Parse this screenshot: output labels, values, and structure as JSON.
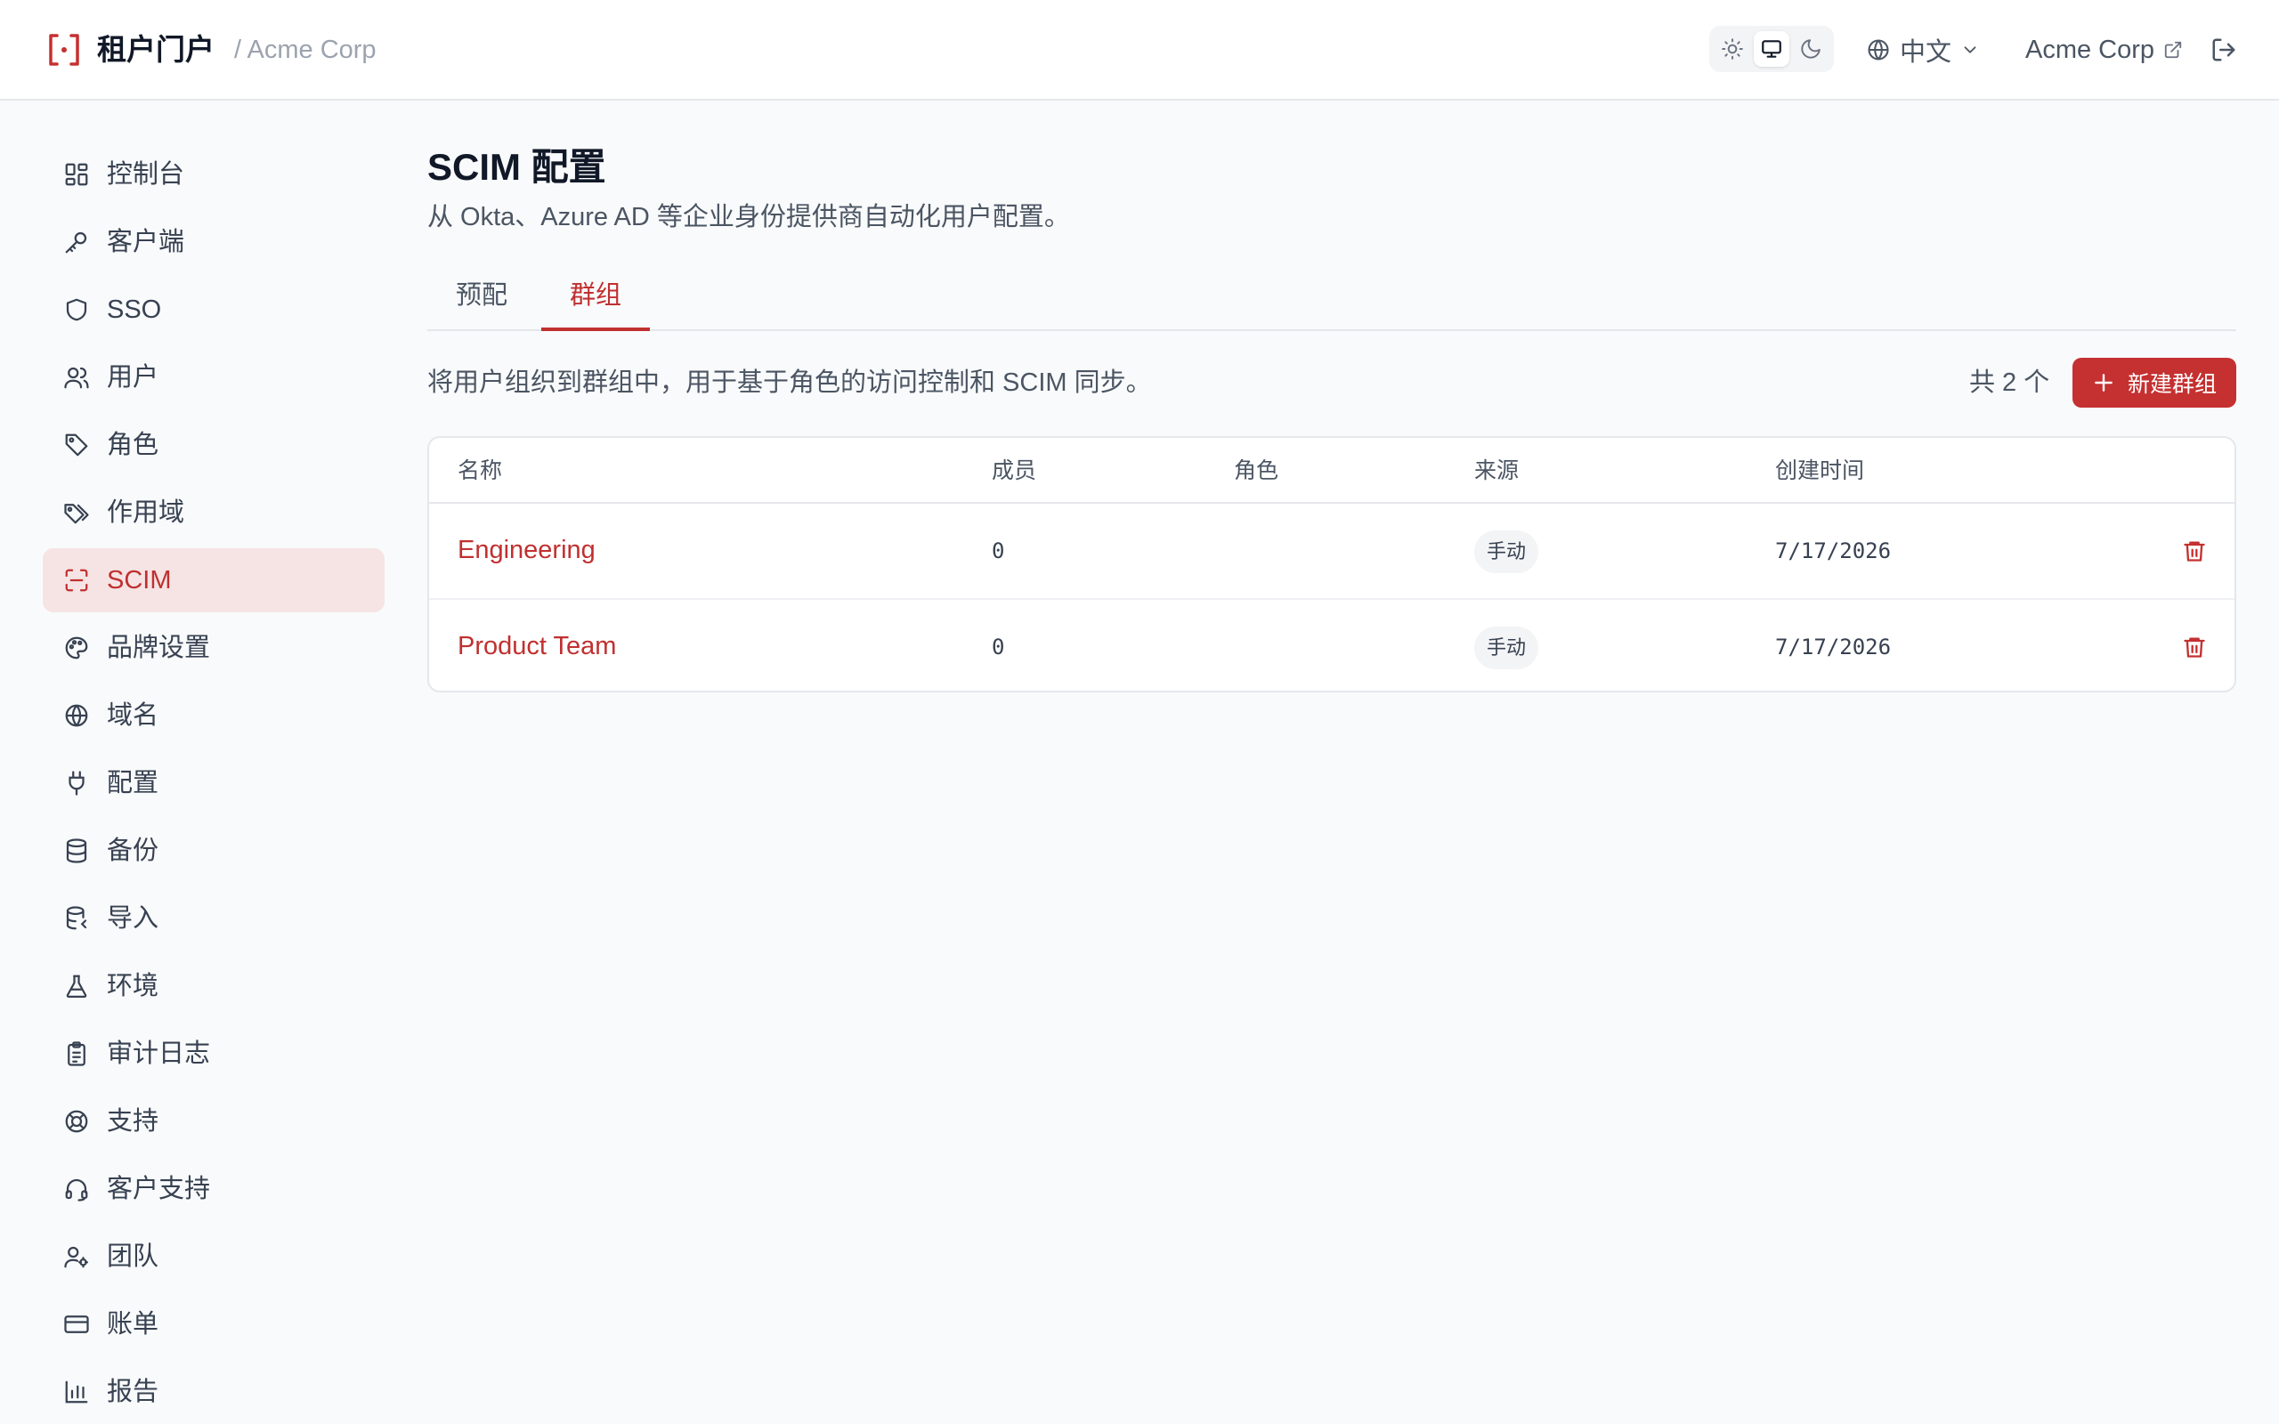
{
  "header": {
    "app_title": "租户门户",
    "tenant_crumb": "/ Acme Corp",
    "theme_modes": [
      "sun-icon",
      "monitor-icon",
      "moon-icon"
    ],
    "theme_active": "monitor-icon",
    "language": "中文",
    "tenant_link": "Acme Corp"
  },
  "sidebar": {
    "items": [
      {
        "label": "控制台",
        "icon": "dashboard-icon"
      },
      {
        "label": "客户端",
        "icon": "key-icon"
      },
      {
        "label": "SSO",
        "icon": "shield-icon"
      },
      {
        "label": "用户",
        "icon": "users-icon"
      },
      {
        "label": "角色",
        "icon": "tag-icon"
      },
      {
        "label": "作用域",
        "icon": "tags-icon"
      },
      {
        "label": "SCIM",
        "icon": "scan-icon",
        "active": true
      },
      {
        "label": "品牌设置",
        "icon": "palette-icon"
      },
      {
        "label": "域名",
        "icon": "globe-icon"
      },
      {
        "label": "配置",
        "icon": "plug-icon"
      },
      {
        "label": "备份",
        "icon": "database-icon"
      },
      {
        "label": "导入",
        "icon": "database-import-icon"
      },
      {
        "label": "环境",
        "icon": "flask-icon"
      },
      {
        "label": "审计日志",
        "icon": "clipboard-icon"
      },
      {
        "label": "支持",
        "icon": "life-buoy-icon"
      },
      {
        "label": "客户支持",
        "icon": "headset-icon"
      },
      {
        "label": "团队",
        "icon": "user-cog-icon"
      },
      {
        "label": "账单",
        "icon": "credit-card-icon"
      },
      {
        "label": "报告",
        "icon": "bar-chart-icon"
      }
    ]
  },
  "main": {
    "title": "SCIM 配置",
    "subtitle": "从 Okta、Azure AD 等企业身份提供商自动化用户配置。",
    "tabs": [
      {
        "label": "预配"
      },
      {
        "label": "群组",
        "active": true
      }
    ],
    "description": "将用户组织到群组中，用于基于角色的访问控制和 SCIM 同步。",
    "count": "共 2 个",
    "new_group_label": "新建群组",
    "table": {
      "columns": [
        "名称",
        "成员",
        "角色",
        "来源",
        "创建时间"
      ],
      "rows": [
        {
          "name": "Engineering",
          "members": "0",
          "roles": "",
          "source": "手动",
          "created": "7/17/2026"
        },
        {
          "name": "Product Team",
          "members": "0",
          "roles": "",
          "source": "手动",
          "created": "7/17/2026"
        }
      ]
    }
  },
  "colors": {
    "accent": "#c53030",
    "active_nav_bg": "#f6e4e4",
    "text_muted": "#4b5563"
  }
}
